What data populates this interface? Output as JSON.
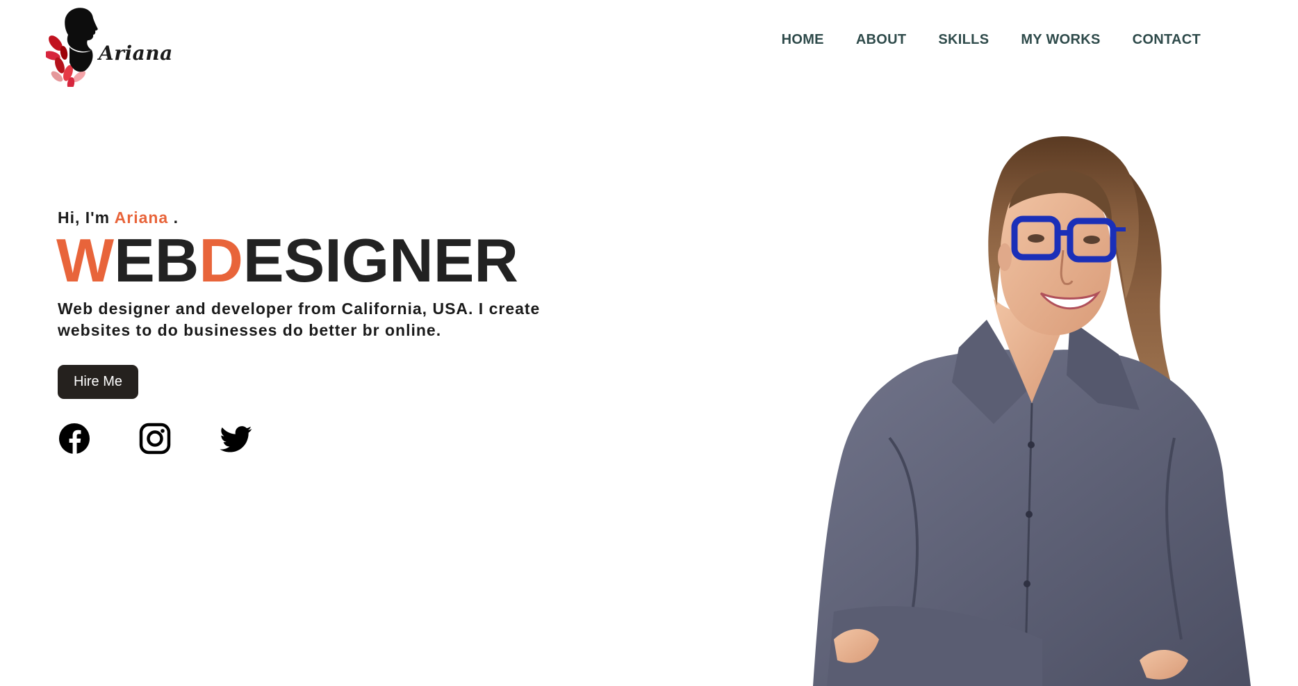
{
  "brand": {
    "name": "Ariana"
  },
  "nav": {
    "items": [
      {
        "label": "HOME"
      },
      {
        "label": "ABOUT"
      },
      {
        "label": "SKILLS"
      },
      {
        "label": "MY WORKS"
      },
      {
        "label": "CONTACT"
      }
    ]
  },
  "hero": {
    "greeting_prefix": "Hi, I'm",
    "greeting_name": "Ariana",
    "greeting_suffix": ".",
    "headline": {
      "part1_accent": "W",
      "part2": "EB",
      "part3_accent": "D",
      "part4": "ESIGNER"
    },
    "description": "Web designer and developer from California, USA. I create websites to do businesses do better br online.",
    "cta_label": "Hire Me"
  },
  "socials": [
    {
      "icon": "facebook-icon"
    },
    {
      "icon": "instagram-icon"
    },
    {
      "icon": "twitter-icon"
    }
  ],
  "colors": {
    "accent": "#e8643a",
    "text_dark": "#222222",
    "nav_text": "#2e4a4a",
    "button_bg": "#25211e",
    "glasses": "#1a2fb8",
    "shirt": "#5f6277"
  }
}
